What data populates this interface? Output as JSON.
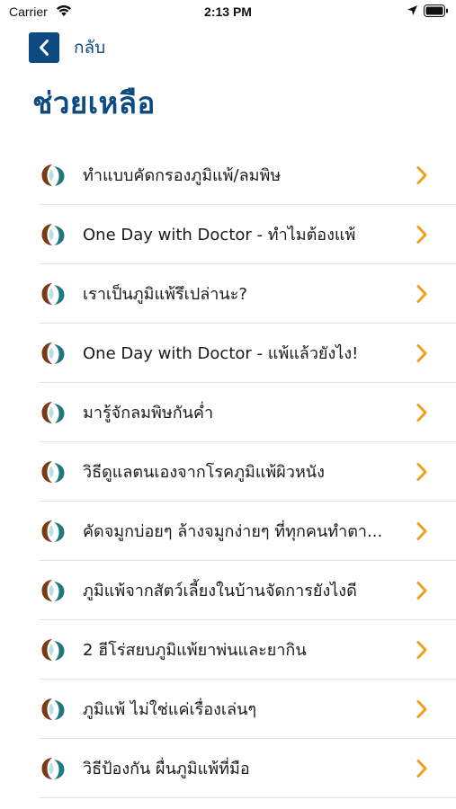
{
  "status_bar": {
    "carrier": "Carrier",
    "time": "2:13 PM"
  },
  "nav": {
    "back_label": "กลับ"
  },
  "page": {
    "title": "ช่วยเหลือ"
  },
  "colors": {
    "brand_blue": "#0e4a82",
    "chevron_orange": "#f0a020",
    "logo_brown": "#7a3b14",
    "logo_teal": "#1e7a80"
  },
  "list": {
    "items": [
      {
        "label": "ทำแบบคัดกรองภูมิแพ้/ลมพิษ"
      },
      {
        "label": "One Day with Doctor - ทำไมต้องแพ้"
      },
      {
        "label": "เราเป็นภูมิแพ้รึเปล่านะ?"
      },
      {
        "label": "One Day with Doctor - แพ้แล้วยังไง!"
      },
      {
        "label": "มารู้จักลมพิษกันค่ำ"
      },
      {
        "label": "วิธีดูแลตนเองจากโรคภูมิแพ้ผิวหนัง"
      },
      {
        "label": "คัดจมูกบ่อยๆ ล้างจมูกง่ายๆ ที่ทุกคนทำตา..."
      },
      {
        "label": "ภูมิแพ้จากสัตว์เลี้ยงในบ้านจัดการยังไงดี"
      },
      {
        "label": "2 ฮีโร่สยบภูมิแพ้ยาพ่นและยากิน"
      },
      {
        "label": "ภูมิแพ้ ไม่ใช่แค่เรื่องเล่นๆ"
      },
      {
        "label": "วิธีป้องกัน ผื่นภูมิแพ้ที่มือ"
      }
    ]
  }
}
